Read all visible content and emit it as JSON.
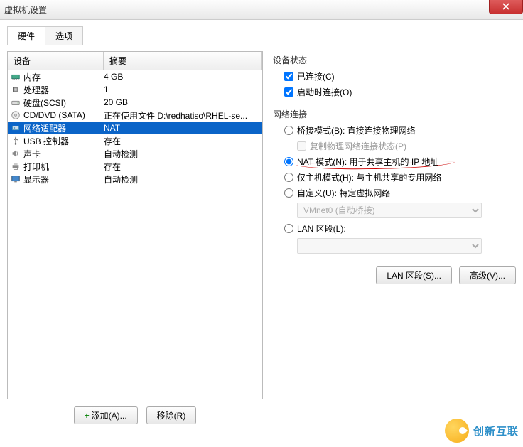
{
  "window": {
    "title": "虚拟机设置"
  },
  "tabs": {
    "hardware": "硬件",
    "options": "选项"
  },
  "list": {
    "header_device": "设备",
    "header_summary": "摘要",
    "rows": [
      {
        "name": "内存",
        "summary": "4 GB"
      },
      {
        "name": "处理器",
        "summary": "1"
      },
      {
        "name": "硬盘(SCSI)",
        "summary": "20 GB"
      },
      {
        "name": "CD/DVD (SATA)",
        "summary": "正在使用文件 D:\\redhatiso\\RHEL-se..."
      },
      {
        "name": "网络适配器",
        "summary": "NAT"
      },
      {
        "name": "USB 控制器",
        "summary": "存在"
      },
      {
        "name": "声卡",
        "summary": "自动检测"
      },
      {
        "name": "打印机",
        "summary": "存在"
      },
      {
        "name": "显示器",
        "summary": "自动检测"
      }
    ]
  },
  "buttons": {
    "add": "添加(A)...",
    "remove": "移除(R)",
    "lan_segments": "LAN 区段(S)...",
    "advanced": "高级(V)..."
  },
  "status": {
    "title": "设备状态",
    "connected": "已连接(C)",
    "connect_at_poweron": "启动时连接(O)"
  },
  "network": {
    "title": "网络连接",
    "bridged": "桥接模式(B): 直接连接物理网络",
    "replicate": "复制物理网络连接状态(P)",
    "nat": "NAT 模式(N): 用于共享主机的 IP 地址",
    "hostonly": "仅主机模式(H): 与主机共享的专用网络",
    "custom": "自定义(U): 特定虚拟网络",
    "custom_combo": "VMnet0 (自动桥接)",
    "lan": "LAN 区段(L):",
    "lan_combo": ""
  },
  "watermark": "创新互联"
}
